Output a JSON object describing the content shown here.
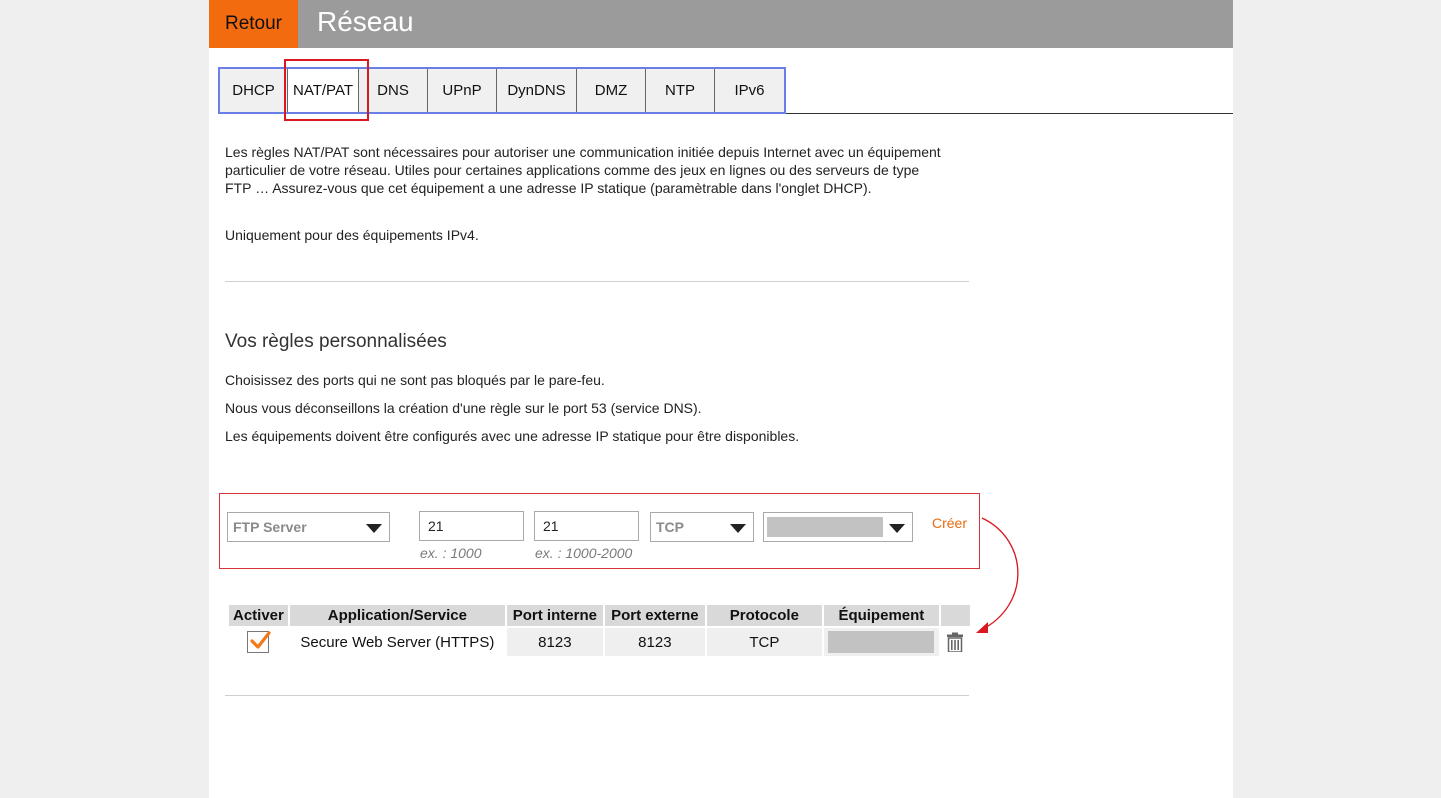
{
  "header": {
    "back_label": "Retour",
    "title": "Réseau",
    "back_color": "#f26b0f",
    "bar_color": "#9b9b9b"
  },
  "tabs": [
    {
      "label": "DHCP",
      "active": false
    },
    {
      "label": "NAT/PAT",
      "active": true
    },
    {
      "label": "DNS",
      "active": false
    },
    {
      "label": "UPnP",
      "active": false
    },
    {
      "label": "DynDNS",
      "active": false
    },
    {
      "label": "DMZ",
      "active": false
    },
    {
      "label": "NTP",
      "active": false
    },
    {
      "label": "IPv6",
      "active": false
    }
  ],
  "intro": {
    "text": "Les règles NAT/PAT sont nécessaires pour autoriser une communication initiée depuis Internet avec un équipement particulier de votre réseau. Utiles pour certaines applications comme des jeux en lignes ou des serveurs de type FTP … Assurez-vous que cet équipement a une adresse IP statique (paramètrable dans l'onglet DHCP).",
    "note": "Uniquement pour des équipements IPv4."
  },
  "custom_rules": {
    "title": "Vos règles personnalisées",
    "notes": [
      "Choisissez des ports qui ne sont pas bloqués par le pare-feu.",
      "Nous vous déconseillons la création d'une règle sur le port 53 (service DNS).",
      "Les équipements doivent être configurés avec une adresse IP statique pour être disponibles."
    ]
  },
  "form": {
    "application_value": "FTP Server",
    "port_internal_value": "21",
    "port_internal_hint": "ex. : 1000",
    "port_external_value": "21",
    "port_external_hint": "ex. : 1000-2000",
    "protocol_value": "TCP",
    "create_label": "Créer",
    "accent_color": "#e96a12"
  },
  "table": {
    "headers": [
      "Activer",
      "Application/Service",
      "Port interne",
      "Port externe",
      "Protocole",
      "Équipement",
      ""
    ],
    "rows": [
      {
        "enabled": true,
        "application": "Secure Web Server (HTTPS)",
        "port_internal": "8123",
        "port_external": "8123",
        "protocol": "TCP"
      }
    ]
  },
  "icons": {
    "delete": "trash-icon",
    "check": "checkmark-icon",
    "dropdown": "chevron-down-icon"
  }
}
